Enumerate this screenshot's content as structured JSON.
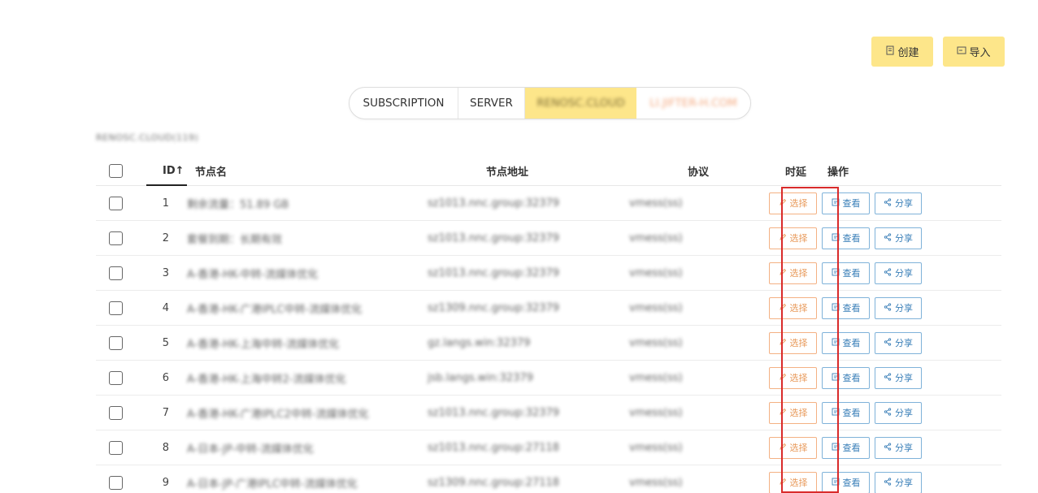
{
  "actions": {
    "create": "创建",
    "import": "导入"
  },
  "tabs": [
    {
      "label": "SUBSCRIPTION"
    },
    {
      "label": "SERVER"
    },
    {
      "label": "RENOSC.CLOUD"
    },
    {
      "label": "LI.JIFTER-H.COM"
    }
  ],
  "section_title": "RENOSC.CLOUD(119)",
  "table": {
    "headers": {
      "id": "ID↑",
      "name": "节点名",
      "addr": "节点地址",
      "proto": "协议",
      "delay": "时延",
      "ops": "操作"
    },
    "op_labels": {
      "select": "选择",
      "view": "查看",
      "share": "分享"
    },
    "rows": [
      {
        "id": "1",
        "name": "剩余流量：51.89 GB",
        "addr": "sz1013.nnc.group:32379",
        "proto": "vmess(ss)"
      },
      {
        "id": "2",
        "name": "套餐到期：长期有效",
        "addr": "sz1013.nnc.group:32379",
        "proto": "vmess(ss)"
      },
      {
        "id": "3",
        "name": "A-香港-HK-中转-流媒体优化",
        "addr": "sz1013.nnc.group:32379",
        "proto": "vmess(ss)"
      },
      {
        "id": "4",
        "name": "A-香港-HK-广港IPLC中转-流媒体优化",
        "addr": "sz1309.nnc.group:32379",
        "proto": "vmess(ss)"
      },
      {
        "id": "5",
        "name": "A-香港-HK-上海中转-流媒体优化",
        "addr": "gz.langs.win:32379",
        "proto": "vmess(ss)"
      },
      {
        "id": "6",
        "name": "A-香港-HK-上海中转2-流媒体优化",
        "addr": "jsb.langs.win:32379",
        "proto": "vmess(ss)"
      },
      {
        "id": "7",
        "name": "A-香港-HK-广港IPLC2中转-流媒体优化",
        "addr": "sz1013.nnc.group:32379",
        "proto": "vmess(ss)"
      },
      {
        "id": "8",
        "name": "A-日本-JP-中转-流媒体优化",
        "addr": "sz1013.nnc.group:27118",
        "proto": "vmess(ss)"
      },
      {
        "id": "9",
        "name": "A-日本-JP-广港IPLC中转-流媒体优化",
        "addr": "sz1309.nnc.group:27118",
        "proto": "vmess(ss)"
      }
    ]
  },
  "colors": {
    "accent": "#fde68a",
    "select": "#e89a5b",
    "view": "#3a7fb8",
    "highlight": "#d92b2b"
  }
}
